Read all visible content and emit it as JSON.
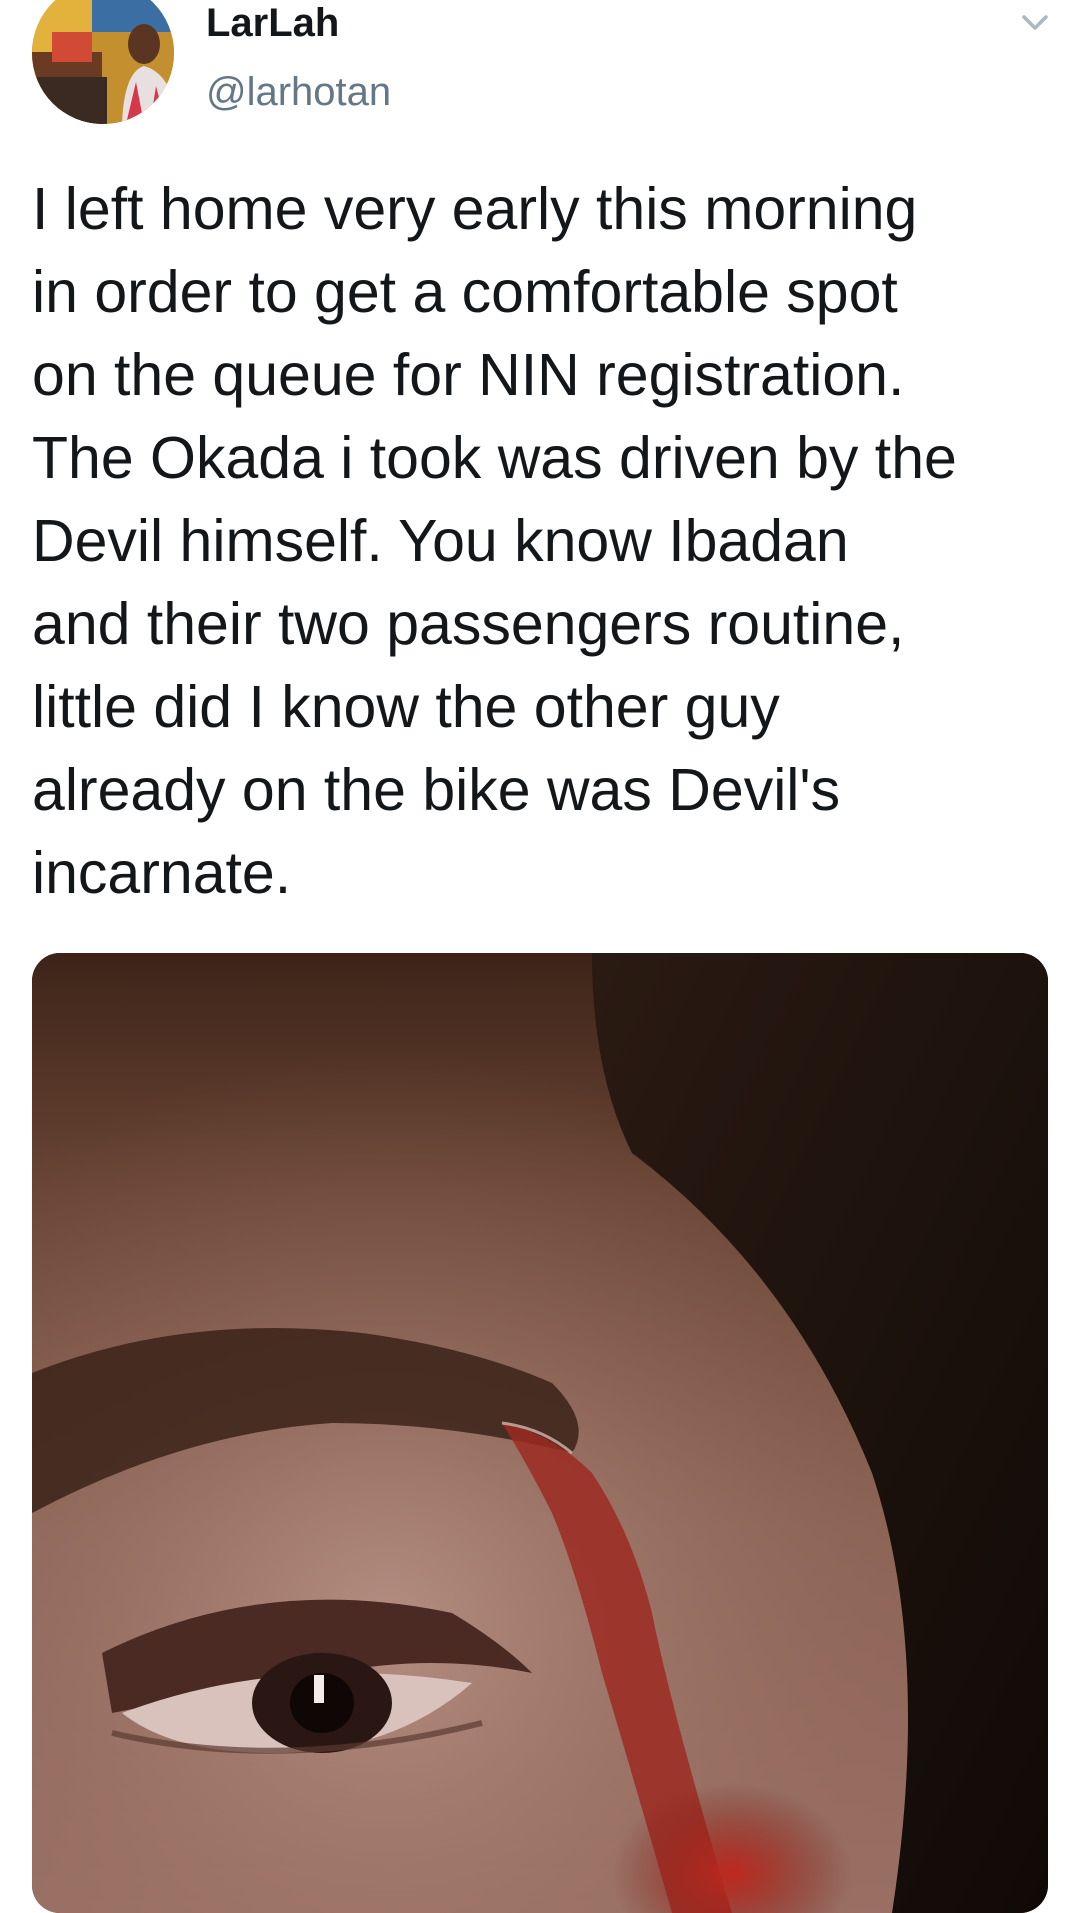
{
  "tweet": {
    "author": {
      "display_name": "LarLah",
      "handle": "@larhotan",
      "avatar_icon": "profile-photo"
    },
    "menu_icon": "chevron-down-icon",
    "text": "I left home very early this morning\nin order to get a comfortable spot\non the queue for NIN registration.\nThe Okada i took was driven by the\nDevil himself. You know Ibadan\nand their two passengers routine,\nlittle did I know the other guy\nalready on the bike was Devil's\nincarnate.",
    "media": {
      "kind": "photo"
    }
  },
  "colors": {
    "text_primary": "#14171a",
    "text_secondary": "#657786",
    "chevron": "#aab8c2",
    "background": "#ffffff"
  }
}
